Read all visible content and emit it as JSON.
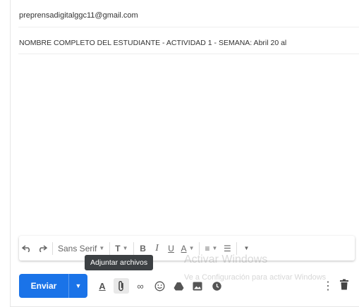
{
  "compose": {
    "recipient": "preprensadigitalggc11@gmail.com",
    "subject": "NOMBRE COMPLETO DEL ESTUDIANTE - ACTIVIDAD 1 - SEMANA: Abril 20 al"
  },
  "format_toolbar": {
    "font_name": "Sans Serif"
  },
  "tooltip": "Adjuntar archivos",
  "send": {
    "label": "Enviar"
  },
  "watermark": {
    "line1": "Activar Windows",
    "line2": "Ve a Configuración para activar Windows"
  },
  "colors": {
    "accent": "#1a73e8",
    "tooltip_bg": "#3c4043"
  }
}
